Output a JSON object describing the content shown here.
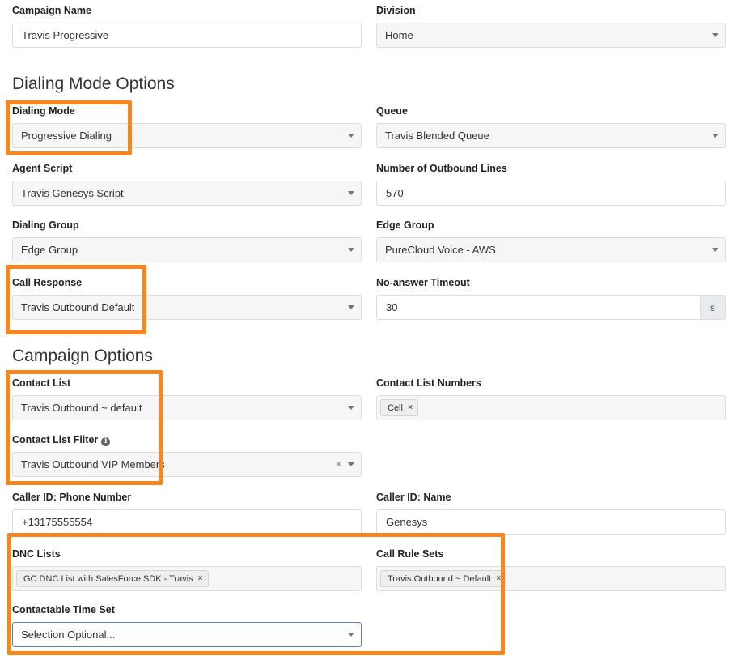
{
  "campaign": {
    "name_label": "Campaign Name",
    "name_value": "Travis Progressive",
    "division_label": "Division",
    "division_value": "Home"
  },
  "dialing": {
    "heading": "Dialing Mode Options",
    "mode_label": "Dialing Mode",
    "mode_value": "Progressive Dialing",
    "queue_label": "Queue",
    "queue_value": "Travis Blended Queue",
    "script_label": "Agent Script",
    "script_value": "Travis Genesys Script",
    "lines_label": "Number of Outbound Lines",
    "lines_value": "570",
    "group_label": "Dialing Group",
    "group_value": "Edge Group",
    "edge_label": "Edge Group",
    "edge_value": "PureCloud Voice - AWS",
    "response_label": "Call Response",
    "response_value": "Travis Outbound Default",
    "timeout_label": "No-answer Timeout",
    "timeout_value": "30",
    "timeout_unit": "s"
  },
  "options": {
    "heading": "Campaign Options",
    "contact_list_label": "Contact List",
    "contact_list_value": "Travis Outbound ~ default",
    "numbers_label": "Contact List Numbers",
    "numbers_tag": "Cell",
    "filter_label": "Contact List Filter",
    "filter_value": "Travis Outbound VIP Members",
    "caller_phone_label": "Caller ID: Phone Number",
    "caller_phone_value": "+13175555554",
    "caller_name_label": "Caller ID: Name",
    "caller_name_value": "Genesys",
    "dnc_label": "DNC Lists",
    "dnc_tag": "GC DNC List with SalesForce SDK - Travis",
    "rules_label": "Call Rule Sets",
    "rules_tag": "Travis Outbound ~ Default",
    "time_set_label": "Contactable Time Set",
    "time_set_value": "Selection Optional..."
  },
  "icons": {
    "tag_remove": "×",
    "clear": "×",
    "info": "i"
  },
  "colors": {
    "highlight": "#f7861e",
    "focus": "#5b7fc7"
  }
}
